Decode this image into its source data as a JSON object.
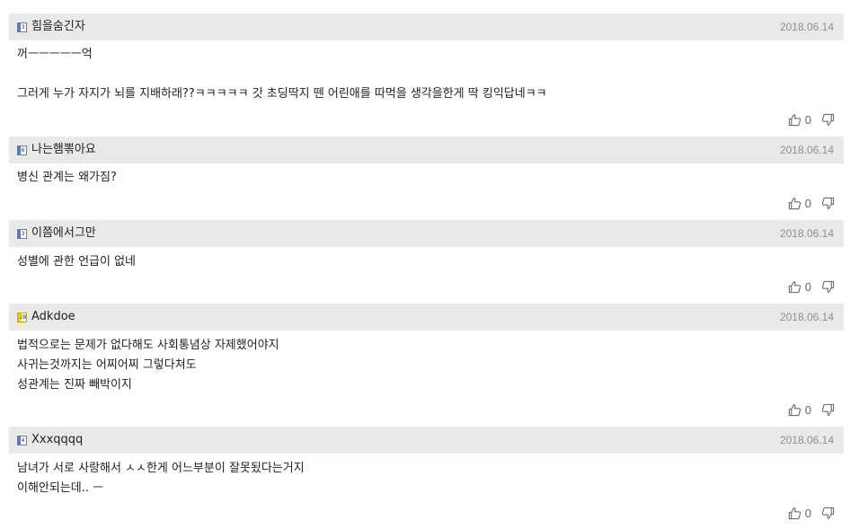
{
  "comments": [
    {
      "level": "3",
      "nickname": "힘을숨긴자",
      "date": "2018.06.14",
      "lines": [
        "꺼ㅡㅡㅡㅡㅡ억",
        "",
        "그러게 누가 자지가 뇌를 지배하래??ㅋㅋㅋㅋㅋ 갓 초딩딱지 뗀 어린애를 따먹을 생각을한게 딱 킹익답네ㅋㅋ"
      ],
      "likes": "0"
    },
    {
      "level": "6",
      "nickname": "나는햄뽂아요",
      "date": "2018.06.14",
      "lines": [
        "병신 관계는 왜가짐?"
      ],
      "likes": "0"
    },
    {
      "level": "3",
      "nickname": "이쯤에서그만",
      "date": "2018.06.14",
      "lines": [
        "성별에 관한 언급이 없네"
      ],
      "likes": "0"
    },
    {
      "level": "28",
      "nickname": "Adkdoe",
      "date": "2018.06.14",
      "lines": [
        "법적으로는 문제가 없다해도 사회통념상 자제했어야지",
        "사귀는것까지는 어찌어찌 그렇다쳐도",
        "성관계는 진짜 빼박이지"
      ],
      "likes": "0"
    },
    {
      "level": "4",
      "nickname": "Xxxqqqq",
      "date": "2018.06.14",
      "lines": [
        "남녀가 서로 사랑해서 ㅅㅅ한게 어느부분이 잘못됬다는거지",
        "이해안되는데.. ㅡ"
      ],
      "likes": "0"
    }
  ],
  "icons": {
    "like": "thumbs-up-icon",
    "dislike": "thumbs-down-icon"
  },
  "colors": {
    "header_bg": "#e9e9e9",
    "date_text": "#8f8f8f",
    "icon_stroke": "#6e6e6e"
  }
}
